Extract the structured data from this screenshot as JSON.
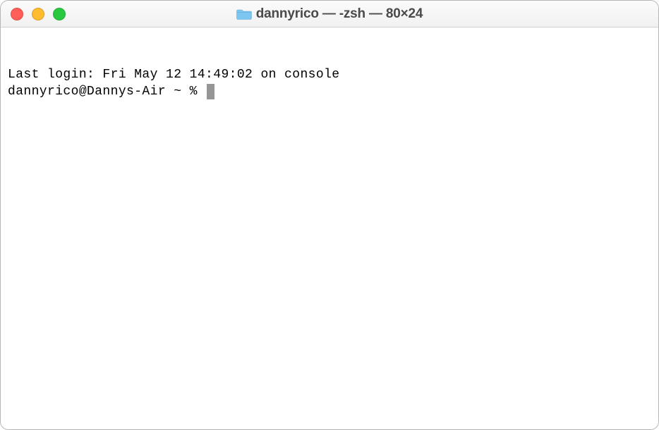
{
  "window": {
    "title": "dannyrico — -zsh — 80×24",
    "icon": "folder-icon"
  },
  "terminal": {
    "last_login": "Last login: Fri May 12 14:49:02 on console",
    "prompt": "dannyrico@Dannys-Air ~ % "
  }
}
